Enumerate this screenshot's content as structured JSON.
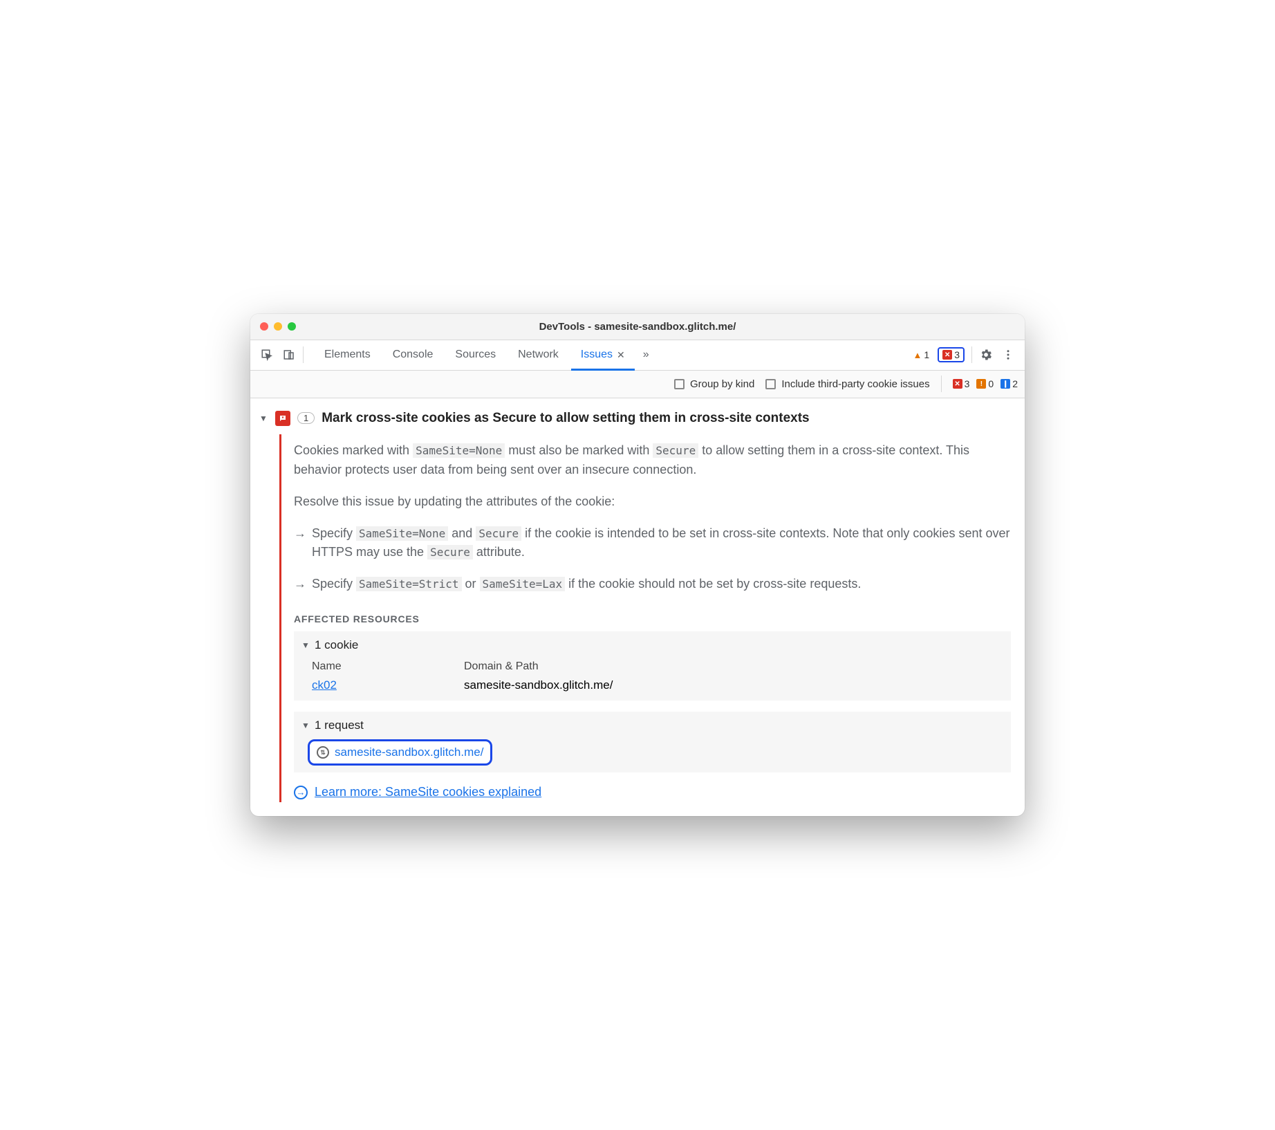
{
  "window": {
    "title": "DevTools - samesite-sandbox.glitch.me/"
  },
  "toolbar": {
    "tabs": [
      "Elements",
      "Console",
      "Sources",
      "Network",
      "Issues"
    ],
    "active_tab": "Issues",
    "warn_count": "1",
    "err_count": "3"
  },
  "subbar": {
    "group_label": "Group by kind",
    "thirdparty_label": "Include third-party cookie issues",
    "counters": {
      "error": "3",
      "warn": "0",
      "info": "2"
    }
  },
  "issue": {
    "count": "1",
    "title": "Mark cross-site cookies as Secure to allow setting them in cross-site contexts",
    "p1a": "Cookies marked with ",
    "p1code1": "SameSite=None",
    "p1b": " must also be marked with ",
    "p1code2": "Secure",
    "p1c": " to allow setting them in a cross-site context. This behavior protects user data from being sent over an insecure connection.",
    "p2": "Resolve this issue by updating the attributes of the cookie:",
    "li1a": "Specify ",
    "li1code1": "SameSite=None",
    "li1b": " and ",
    "li1code2": "Secure",
    "li1c": " if the cookie is intended to be set in cross-site contexts. Note that only cookies sent over HTTPS may use the ",
    "li1code3": "Secure",
    "li1d": " attribute.",
    "li2a": "Specify ",
    "li2code1": "SameSite=Strict",
    "li2b": " or ",
    "li2code2": "SameSite=Lax",
    "li2c": " if the cookie should not be set by cross-site requests.",
    "affected_heading": "AFFECTED RESOURCES",
    "cookie_head": "1 cookie",
    "cols": {
      "name": "Name",
      "domain": "Domain & Path"
    },
    "cookie": {
      "name": "ck02",
      "domain": "samesite-sandbox.glitch.me/"
    },
    "request_head": "1 request",
    "request_url": "samesite-sandbox.glitch.me/",
    "learn": "Learn more: SameSite cookies explained"
  }
}
